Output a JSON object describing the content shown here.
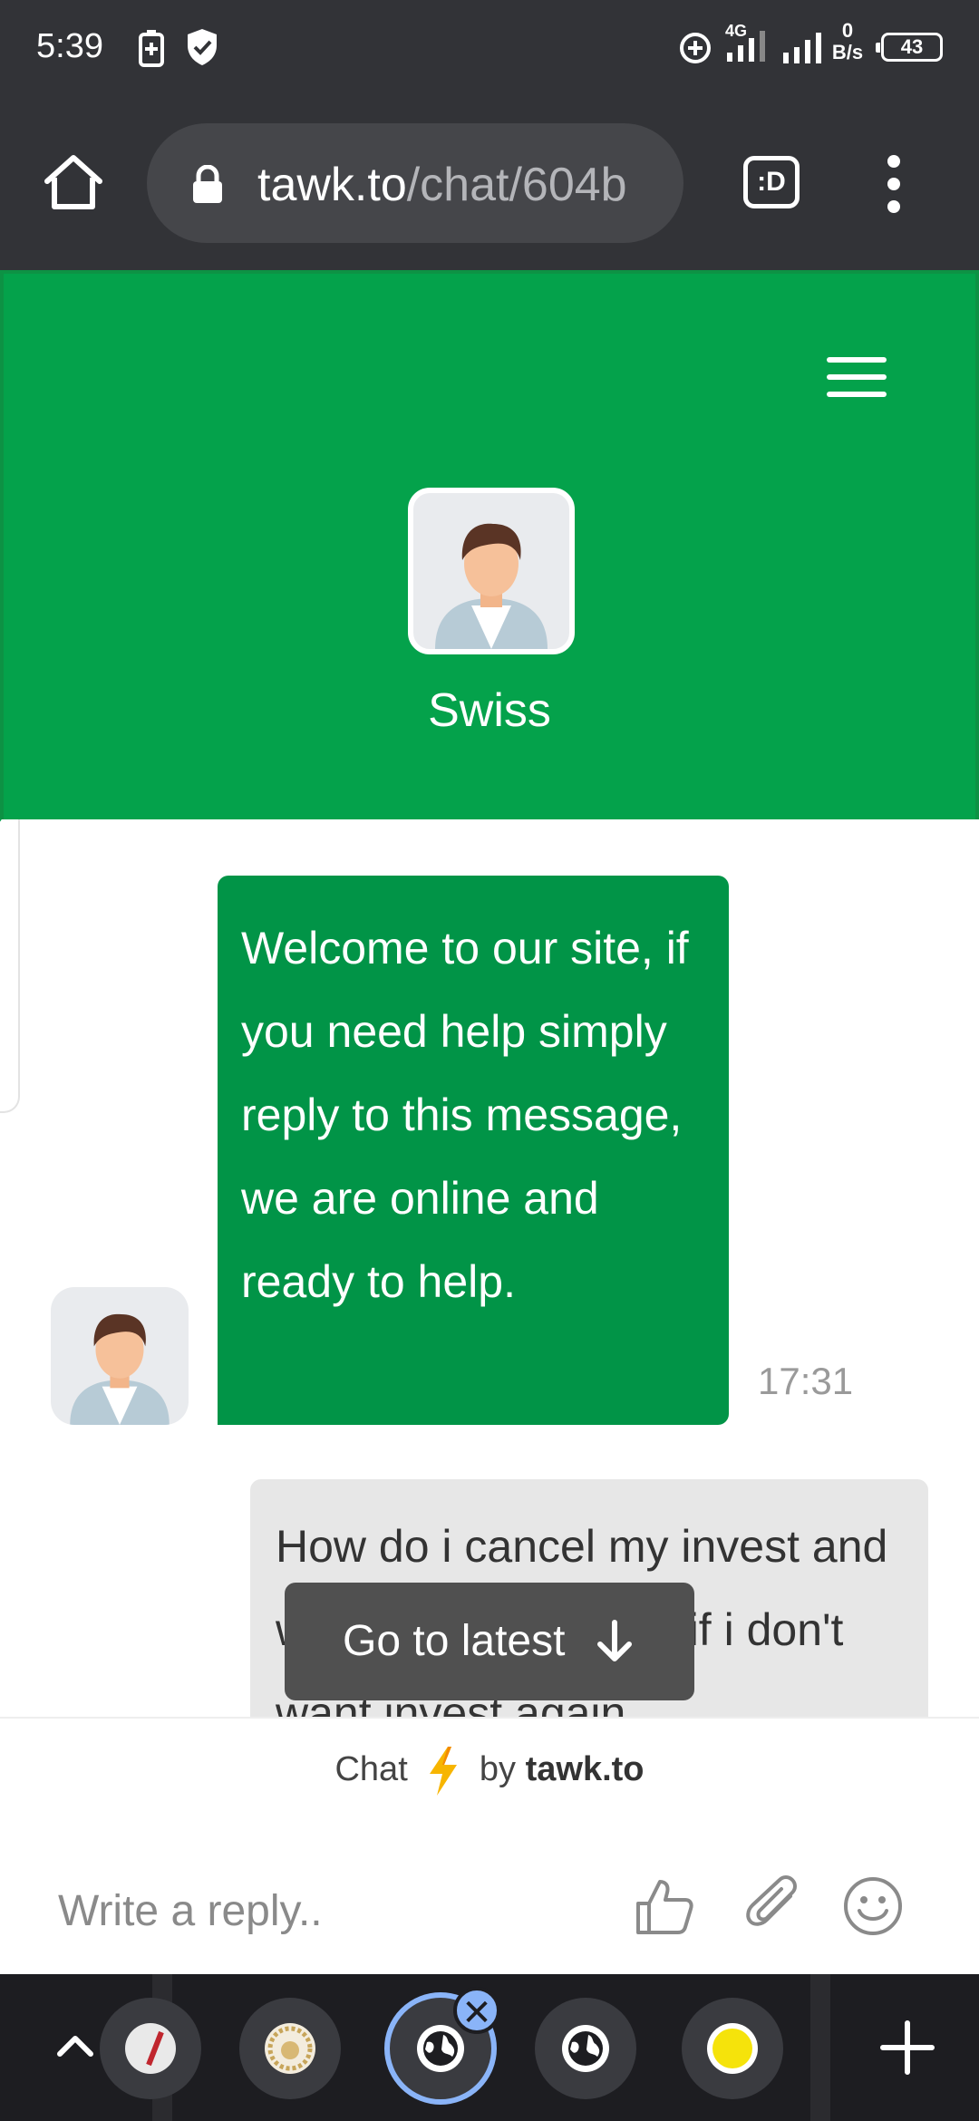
{
  "status_bar": {
    "time": "5:39",
    "network": "4G",
    "net_speed_value": "0",
    "net_speed_unit": "B/s",
    "battery": "43"
  },
  "browser": {
    "url_host": "tawk.to",
    "url_path": "/chat/604b",
    "tab_switcher_label": ":D"
  },
  "chat": {
    "agent_name": "Swiss",
    "messages": [
      {
        "from": "agent",
        "text": "Welcome to our site, if you need help simply reply to this message, we are online and ready to help.",
        "time": "17:31"
      },
      {
        "from": "user",
        "text": "How do i cancel my invest and withdraw my money if i don't want invest again"
      }
    ],
    "go_latest_label": "Go to latest"
  },
  "branding": {
    "prefix": "Chat",
    "by": "by",
    "brand": "tawk.to"
  },
  "composer": {
    "placeholder": "Write a reply.."
  },
  "tab_strip": {
    "close_symbol": "✕",
    "colors": {
      "yellow_tab": "#f5e30b"
    }
  },
  "colors": {
    "header_green": "#04a24b",
    "agent_bubble": "#019447",
    "user_bubble": "#e7e7e7",
    "browser_chrome": "#323337"
  }
}
